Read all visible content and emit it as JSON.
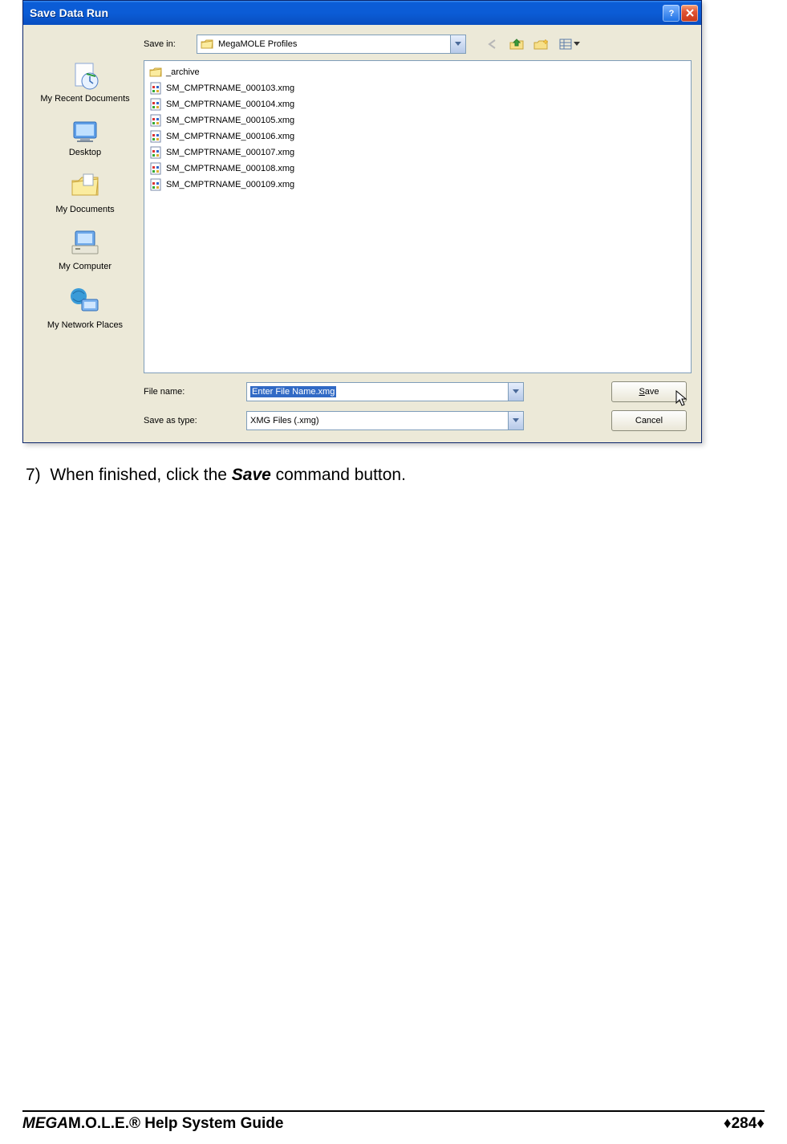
{
  "dialog": {
    "title": "Save Data Run",
    "save_in_label": "Save in:",
    "save_in_value": "MegaMOLE Profiles",
    "places": [
      {
        "label": "My Recent Documents"
      },
      {
        "label": "Desktop"
      },
      {
        "label": "My Documents"
      },
      {
        "label": "My Computer"
      },
      {
        "label": "My Network Places"
      }
    ],
    "files": [
      {
        "name": "_archive",
        "type": "folder"
      },
      {
        "name": "SM_CMPTRNAME_000103.xmg",
        "type": "file"
      },
      {
        "name": "SM_CMPTRNAME_000104.xmg",
        "type": "file"
      },
      {
        "name": "SM_CMPTRNAME_000105.xmg",
        "type": "file"
      },
      {
        "name": "SM_CMPTRNAME_000106.xmg",
        "type": "file"
      },
      {
        "name": "SM_CMPTRNAME_000107.xmg",
        "type": "file"
      },
      {
        "name": "SM_CMPTRNAME_000108.xmg",
        "type": "file"
      },
      {
        "name": "SM_CMPTRNAME_000109.xmg",
        "type": "file"
      }
    ],
    "file_name_label": "File name:",
    "file_name_value": "Enter File Name.xmg",
    "save_as_type_label": "Save as type:",
    "save_as_type_value": "XMG Files (.xmg)",
    "save_button": "Save",
    "cancel_button": "Cancel"
  },
  "doc": {
    "step_num": "7)",
    "step_pre": "When finished, click the ",
    "step_bold": "Save",
    "step_post": " command button.",
    "footer_mega": "MEGA",
    "footer_rest": "M.O.L.E.® Help System Guide",
    "footer_page": "284"
  }
}
